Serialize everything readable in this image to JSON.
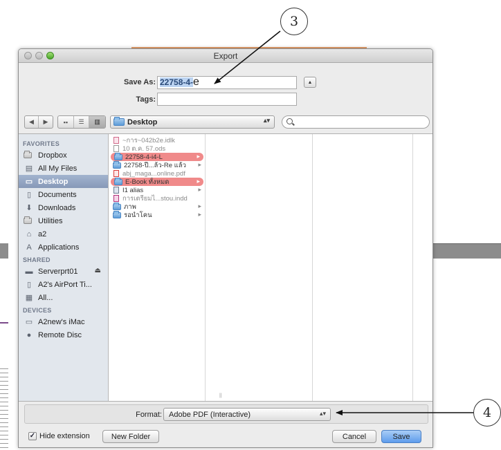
{
  "callouts": {
    "top": "3",
    "right": "4"
  },
  "window": {
    "title": "Export"
  },
  "save_as": {
    "label": "Save As:",
    "value_selected": "22758-4-",
    "value_typed": "e"
  },
  "tags": {
    "label": "Tags:"
  },
  "location": {
    "current": "Desktop"
  },
  "sidebar": {
    "favorites_header": "FAVORITES",
    "favorites": [
      {
        "label": "Dropbox",
        "icon": "folder-icon"
      },
      {
        "label": "All My Files",
        "icon": "all-files-icon"
      },
      {
        "label": "Desktop",
        "icon": "desktop-icon",
        "selected": true
      },
      {
        "label": "Documents",
        "icon": "documents-icon"
      },
      {
        "label": "Downloads",
        "icon": "downloads-icon"
      },
      {
        "label": "Utilities",
        "icon": "folder-icon"
      },
      {
        "label": "a2",
        "icon": "home-icon"
      },
      {
        "label": "Applications",
        "icon": "applications-icon"
      }
    ],
    "shared_header": "SHARED",
    "shared": [
      {
        "label": "Serverprt01",
        "icon": "server-icon"
      },
      {
        "label": "A2's AirPort Ti...",
        "icon": "airport-icon"
      },
      {
        "label": "All...",
        "icon": "network-icon"
      }
    ],
    "devices_header": "DEVICES",
    "devices": [
      {
        "label": "A2new's iMac",
        "icon": "imac-icon"
      },
      {
        "label": "Remote Disc",
        "icon": "disc-icon"
      }
    ]
  },
  "files": [
    {
      "name": "~การ~042b2e.idlk",
      "kind": "doc",
      "dim": true
    },
    {
      "name": "10 ต.ค. 57.ods",
      "kind": "doc",
      "dim": true
    },
    {
      "name": "22758-4-i4-L",
      "kind": "folder",
      "tag": "red"
    },
    {
      "name": "22758-ปี...ล้ว-Re แล้ว",
      "kind": "folder"
    },
    {
      "name": "abj_maga...online.pdf",
      "kind": "pdf",
      "dim": true
    },
    {
      "name": "E-Book ทั้งหมด",
      "kind": "folder",
      "tag": "red"
    },
    {
      "name": "I1 alias",
      "kind": "alias"
    },
    {
      "name": "การเตรียมไ...stou.indd",
      "kind": "indd",
      "dim": true
    },
    {
      "name": "ภาพ",
      "kind": "folder"
    },
    {
      "name": "รอนำโคน",
      "kind": "folder"
    }
  ],
  "format": {
    "label": "Format:",
    "value": "Adobe PDF (Interactive)"
  },
  "bottom": {
    "hide_extension": "Hide extension",
    "hide_extension_checked": true,
    "new_folder": "New Folder",
    "cancel": "Cancel",
    "save": "Save"
  }
}
